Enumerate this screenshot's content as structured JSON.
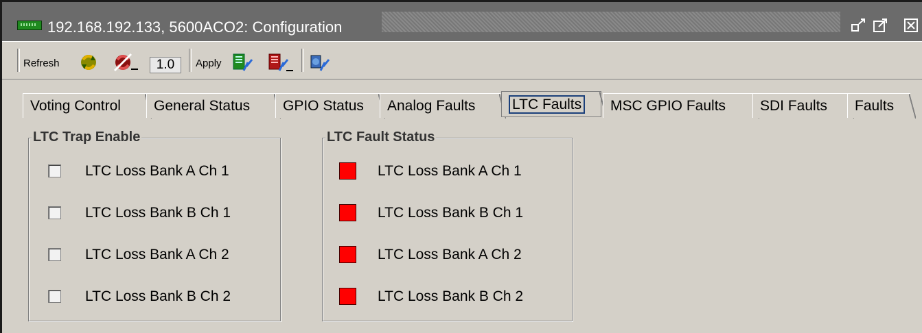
{
  "window": {
    "title": "192.168.192.133, 5600ACO2: Configuration",
    "icon": "card-icon"
  },
  "toolbar": {
    "refresh_label": "Refresh",
    "rate_value": "1.0",
    "apply_label": "Apply"
  },
  "tabs": [
    {
      "label": "Voting Control",
      "active": false
    },
    {
      "label": "General Status",
      "active": false
    },
    {
      "label": "GPIO Status",
      "active": false
    },
    {
      "label": "Analog Faults",
      "active": false
    },
    {
      "label": "LTC Faults",
      "active": true
    },
    {
      "label": "MSC GPIO Faults",
      "active": false
    },
    {
      "label": "SDI Faults",
      "active": false
    },
    {
      "label": "Faults",
      "active": false
    }
  ],
  "trap_enable": {
    "title": "LTC Trap Enable",
    "items": [
      {
        "label": "LTC Loss Bank A Ch 1",
        "checked": false
      },
      {
        "label": "LTC Loss Bank B Ch 1",
        "checked": false
      },
      {
        "label": "LTC Loss Bank A Ch 2",
        "checked": false
      },
      {
        "label": "LTC Loss Bank B Ch 2",
        "checked": false
      }
    ]
  },
  "fault_status": {
    "title": "LTC Fault Status",
    "items": [
      {
        "label": "LTC Loss Bank A Ch 1",
        "state": "fault"
      },
      {
        "label": "LTC Loss Bank B Ch 1",
        "state": "fault"
      },
      {
        "label": "LTC Loss Bank A Ch 2",
        "state": "fault"
      },
      {
        "label": "LTC Loss Bank B Ch 2",
        "state": "fault"
      }
    ]
  },
  "colors": {
    "fault": "#ff0000",
    "panel": "#d4d0c8",
    "titlebar": "#6b6b6b",
    "active_tab_focus": "#1a3f7a"
  }
}
